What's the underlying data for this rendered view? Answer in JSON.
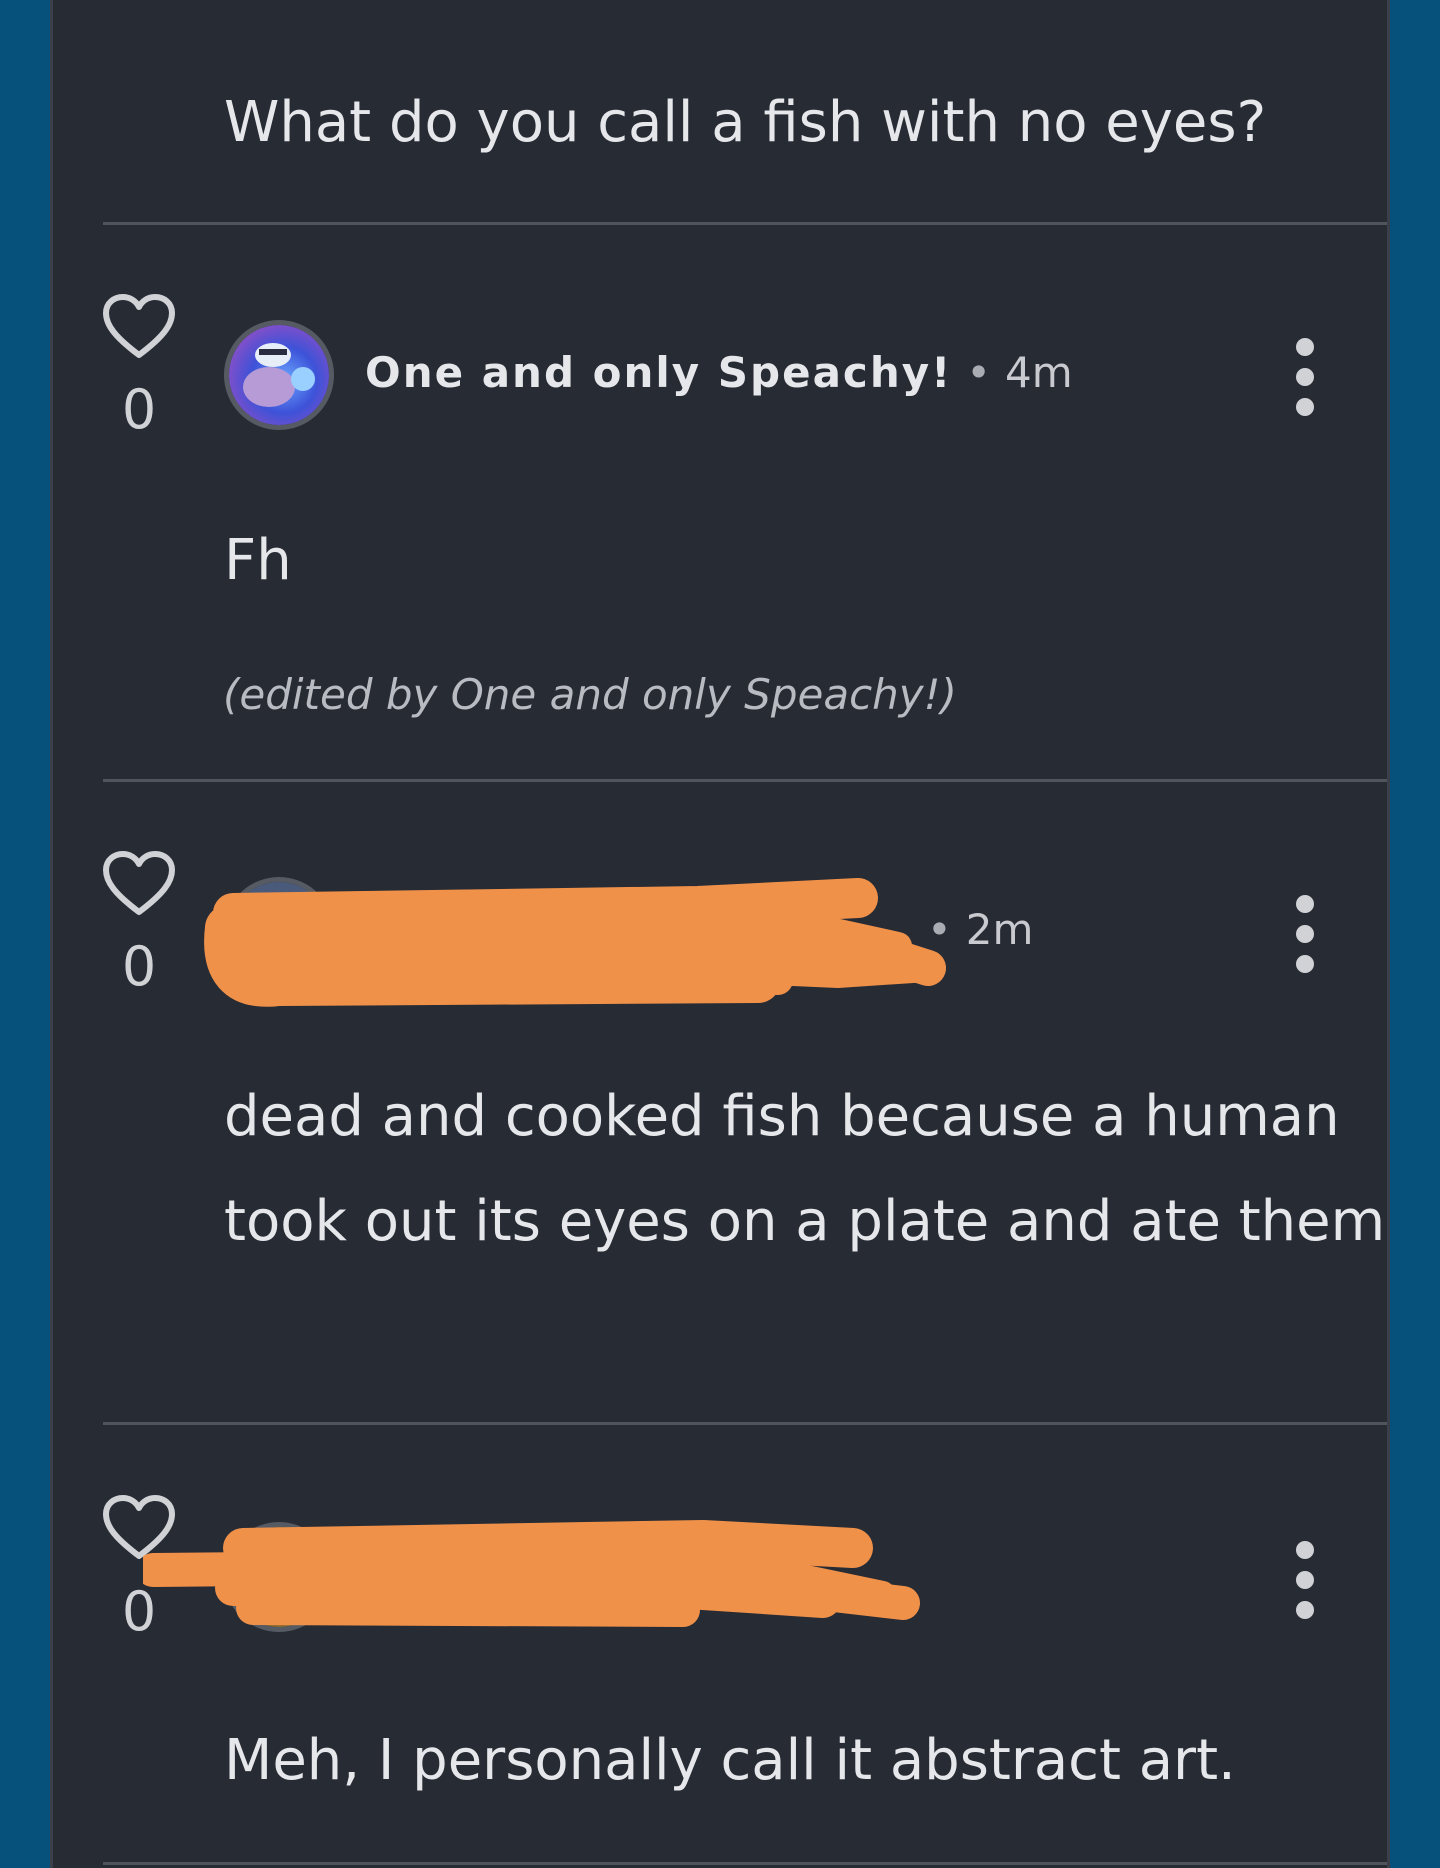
{
  "question": "What do you call a fish with no eyes?",
  "posts": [
    {
      "likes": "0",
      "author": "One and only Speachy!",
      "separator": "•",
      "time": "4m",
      "body": "Fh",
      "edited_note": "(edited by One and only Speachy!)",
      "icons": {
        "like": "heart-icon",
        "menu": "more-vertical-icon"
      }
    },
    {
      "likes": "0",
      "separator": "•",
      "time": "2m",
      "body": "dead and cooked fish because a human took out its eyes on a plate and ate them",
      "icons": {
        "like": "heart-icon",
        "menu": "more-vertical-icon"
      }
    },
    {
      "likes": "0",
      "body": "Meh, I personally call it abstract art.",
      "icons": {
        "like": "heart-icon",
        "menu": "more-vertical-icon"
      }
    }
  ],
  "colors": {
    "outer_background": "#06507c",
    "panel_background": "#272b34",
    "divider": "#50545d",
    "text": "#e6e7ea",
    "redaction": "#f0914a"
  }
}
